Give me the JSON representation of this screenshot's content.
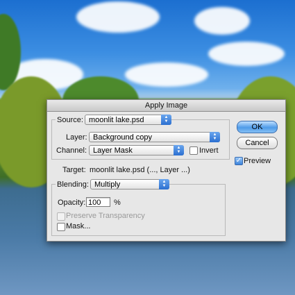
{
  "dialog": {
    "title": "Apply Image"
  },
  "source": {
    "label": "Source:",
    "value": "moonlit lake.psd",
    "layer_label": "Layer:",
    "layer_value": "Background copy",
    "channel_label": "Channel:",
    "channel_value": "Layer Mask",
    "invert_label": "Invert",
    "invert_checked": false
  },
  "target": {
    "label": "Target:",
    "value": "moonlit lake.psd (..., Layer ...)"
  },
  "blending": {
    "label": "Blending:",
    "value": "Multiply",
    "opacity_label": "Opacity:",
    "opacity_value": "100",
    "opacity_unit": "%",
    "preserve_label": "Preserve Transparency",
    "preserve_enabled": false,
    "mask_label": "Mask...",
    "mask_checked": false
  },
  "buttons": {
    "ok": "OK",
    "cancel": "Cancel"
  },
  "preview": {
    "label": "Preview",
    "checked": true
  },
  "icons": {
    "popup_arrows": "updown-arrows-icon",
    "check": "checkmark-icon"
  },
  "colors": {
    "accent": "#3b82db",
    "dialog_bg": "#e7e7e7"
  }
}
